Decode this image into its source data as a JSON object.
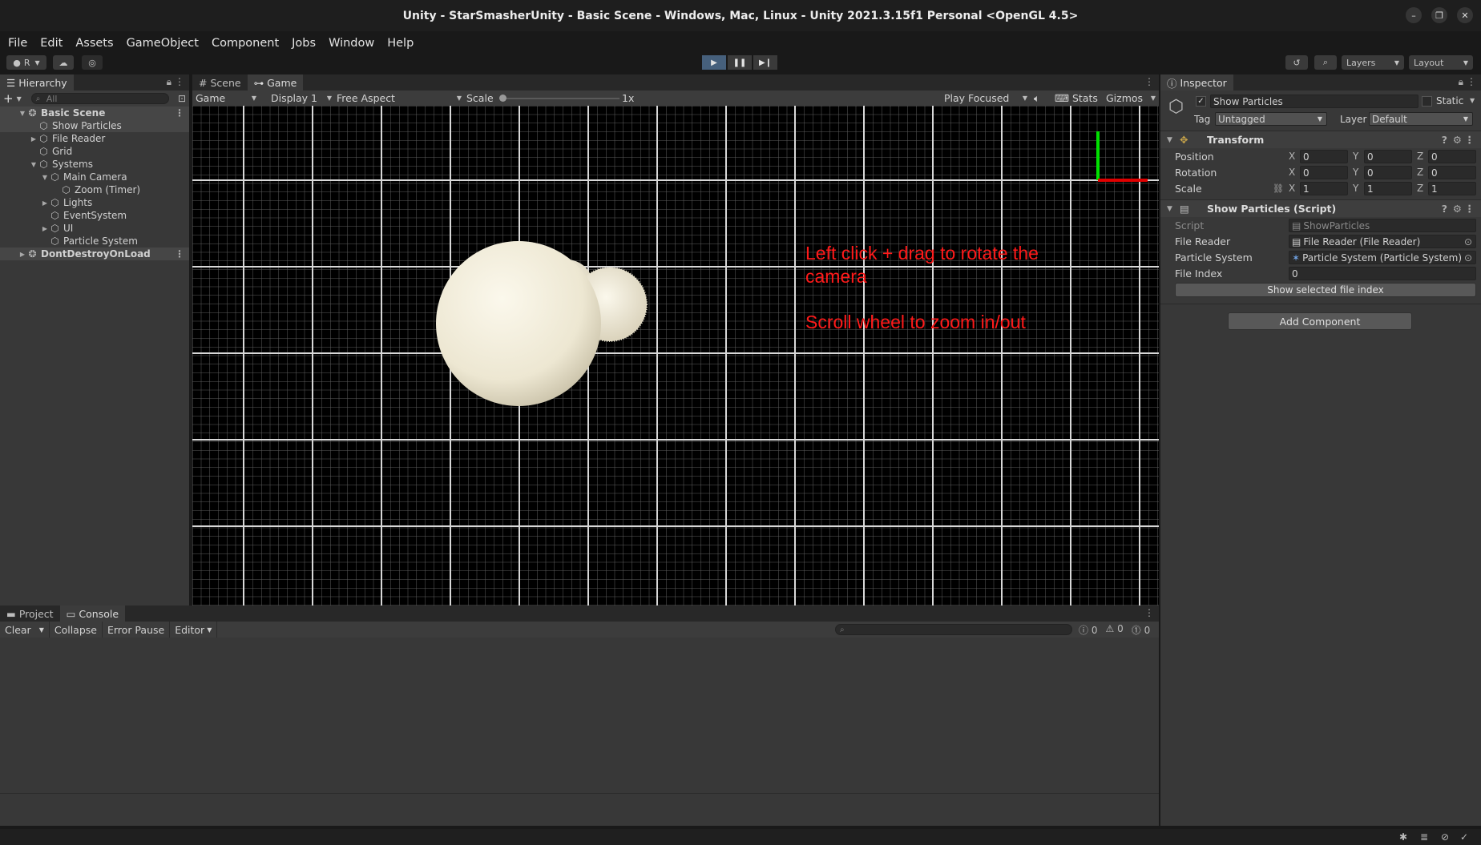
{
  "window": {
    "title": "Unity - StarSmasherUnity - Basic Scene - Windows, Mac, Linux - Unity 2021.3.15f1 Personal <OpenGL 4.5>"
  },
  "menu": [
    "File",
    "Edit",
    "Assets",
    "GameObject",
    "Component",
    "Jobs",
    "Window",
    "Help"
  ],
  "toolbar": {
    "account_label": "R",
    "layers_label": "Layers",
    "layout_label": "Layout"
  },
  "hierarchy": {
    "tab": "Hierarchy",
    "search_placeholder": "All",
    "items": [
      {
        "label": "Basic Scene",
        "depth": 0,
        "expanded": true,
        "type": "scene"
      },
      {
        "label": "Show Particles",
        "depth": 1,
        "expanded": null,
        "type": "object",
        "selected": true
      },
      {
        "label": "File Reader",
        "depth": 1,
        "expanded": false,
        "type": "object"
      },
      {
        "label": "Grid",
        "depth": 1,
        "expanded": null,
        "type": "object"
      },
      {
        "label": "Systems",
        "depth": 1,
        "expanded": true,
        "type": "object"
      },
      {
        "label": "Main Camera",
        "depth": 2,
        "expanded": true,
        "type": "object"
      },
      {
        "label": "Zoom (Timer)",
        "depth": 3,
        "expanded": null,
        "type": "object"
      },
      {
        "label": "Lights",
        "depth": 2,
        "expanded": false,
        "type": "object"
      },
      {
        "label": "EventSystem",
        "depth": 2,
        "expanded": null,
        "type": "object"
      },
      {
        "label": "UI",
        "depth": 2,
        "expanded": false,
        "type": "object"
      },
      {
        "label": "Particle System",
        "depth": 2,
        "expanded": null,
        "type": "object"
      },
      {
        "label": "DontDestroyOnLoad",
        "depth": 0,
        "expanded": false,
        "type": "scene"
      }
    ]
  },
  "scene_tabs": [
    {
      "label": "Scene",
      "icon": "hash-icon",
      "active": false
    },
    {
      "label": "Game",
      "icon": "gamepad-icon",
      "active": true
    }
  ],
  "game_toolbar": {
    "mode": "Game",
    "display": "Display 1",
    "aspect": "Free Aspect",
    "scale_label": "Scale",
    "scale_value": "1x",
    "play_mode": "Play Focused",
    "stats": "Stats",
    "gizmos": "Gizmos"
  },
  "game_view": {
    "instructions_1": "Left click + drag to rotate the camera",
    "instructions_2": "Scroll wheel to zoom in/out",
    "text_color": "#ff1a1a"
  },
  "inspector": {
    "tab": "Inspector",
    "object_name": "Show Particles",
    "active": true,
    "static_label": "Static",
    "tag_label": "Tag",
    "tag_value": "Untagged",
    "layer_label": "Layer",
    "layer_value": "Default",
    "transform": {
      "title": "Transform",
      "position": {
        "label": "Position",
        "x": "0",
        "y": "0",
        "z": "0"
      },
      "rotation": {
        "label": "Rotation",
        "x": "0",
        "y": "0",
        "z": "0"
      },
      "scale": {
        "label": "Scale",
        "x": "1",
        "y": "1",
        "z": "1"
      }
    },
    "script_component": {
      "title": "Show Particles (Script)",
      "script_label": "Script",
      "script_value": "ShowParticles",
      "file_reader_label": "File Reader",
      "file_reader_value": "File Reader (File Reader)",
      "particle_system_label": "Particle System",
      "particle_system_value": "Particle System (Particle System)",
      "file_index_label": "File Index",
      "file_index_value": "0",
      "button_label": "Show selected file index"
    },
    "add_component": "Add Component"
  },
  "console": {
    "tabs": [
      {
        "label": "Project",
        "icon": "folder-icon",
        "active": false
      },
      {
        "label": "Console",
        "icon": "console-icon",
        "active": true
      }
    ],
    "clear": "Clear",
    "collapse": "Collapse",
    "error_pause": "Error Pause",
    "editor": "Editor",
    "count_info": "0",
    "count_warn": "0",
    "count_error": "0"
  },
  "colors": {
    "accent_play": "#46607c",
    "axis_green": "#00e000",
    "axis_red": "#e00000",
    "particle": "#f3efe0"
  }
}
